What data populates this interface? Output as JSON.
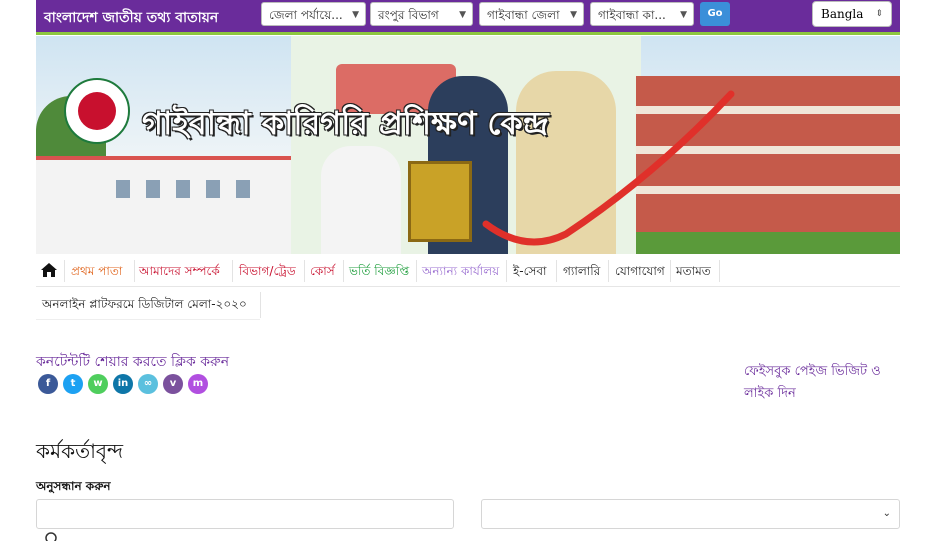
{
  "header": {
    "portal_title": "বাংলাদেশ জাতীয় তথ্য বাতায়ন",
    "selects": [
      {
        "label": "জেলা পর্যায়ে..."
      },
      {
        "label": "রংপুর বিভাগ"
      },
      {
        "label": "গাইবান্ধা জেলা"
      },
      {
        "label": "গাইবান্ধা কা..."
      }
    ],
    "go_label": "Go",
    "language": "Bangla"
  },
  "banner": {
    "title": "গাইবান্ধা কারিগরি প্রশিক্ষণ কেন্দ্র"
  },
  "nav": {
    "items": [
      {
        "label": "প্রথম পাতা",
        "color": "#e0631b"
      },
      {
        "label": "আমাদের সম্পর্কে",
        "color": "#c8102e"
      },
      {
        "label": "বিভাগ/ট্রেড",
        "color": "#c8102e"
      },
      {
        "label": "কোর্স",
        "color": "#c8102e"
      },
      {
        "label": "ভর্তি বিজ্ঞপ্তি",
        "color": "#1e9e3c"
      },
      {
        "label": "অন্যান্য কার্যালয়",
        "color": "#9b6fd1"
      },
      {
        "label": "ই-সেবা",
        "color": "#222222"
      },
      {
        "label": "গ্যালারি",
        "color": "#222222"
      },
      {
        "label": "যোগাযোগ",
        "color": "#222222"
      },
      {
        "label": "মতামত",
        "color": "#222222"
      }
    ],
    "second_row": "অনলাইন প্লাটফরমে ডিজিটাল মেলা-২০২০"
  },
  "share": {
    "label": "কনটেন্টটি শেয়ার করতে ক্লিক করুন",
    "icons": [
      {
        "name": "facebook-icon",
        "glyph": "f",
        "color": "#3b5998"
      },
      {
        "name": "twitter-icon",
        "glyph": "t",
        "color": "#1da1f2"
      },
      {
        "name": "whatsapp-icon",
        "glyph": "w",
        "color": "#4fce5d"
      },
      {
        "name": "linkedin-icon",
        "glyph": "in",
        "color": "#0e76a8"
      },
      {
        "name": "copy-link-icon",
        "glyph": "∞",
        "color": "#5bc0de"
      },
      {
        "name": "viber-icon",
        "glyph": "v",
        "color": "#7b519d"
      },
      {
        "name": "messenger-icon",
        "glyph": "m",
        "color": "#b14fe0"
      }
    ]
  },
  "sidebar": {
    "facebook_visit": "ফেইসবুক পেইজ ভিজিট ও লাইক দিন"
  },
  "main": {
    "officers_title": "কর্মকর্তাবৃন্দ",
    "search_label": "অনুসন্ধান করুন"
  },
  "colors": {
    "topbar": "#6a2c9b",
    "accent_green": "#8dc63f",
    "go_button": "#3b8fd9"
  }
}
